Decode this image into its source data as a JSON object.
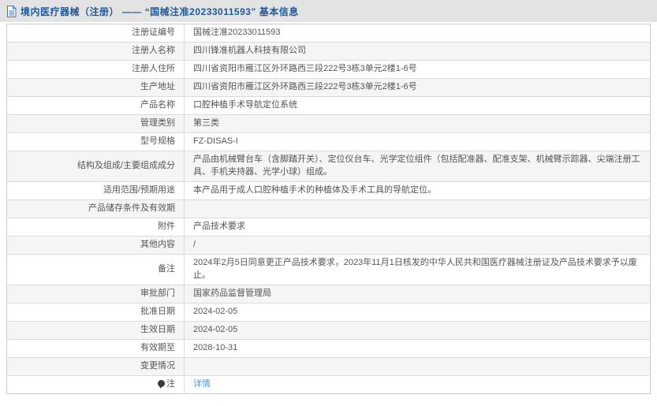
{
  "header": {
    "title": "境内医疗器械（注册） —— “国械注准20233011593” 基本信息",
    "icon": "document-icon",
    "title_color": "#1c5a9e",
    "band_color": "#e3e3e3"
  },
  "colors": {
    "stripe": "#f5f5f5",
    "border": "#dcdcdc",
    "link": "#4b94e0",
    "text": "#555555"
  },
  "table": {
    "rows": [
      {
        "label": "注册证编号",
        "value": "国械注准20233011593"
      },
      {
        "label": "注册人名称",
        "value": "四川锋准机器人科技有限公司"
      },
      {
        "label": "注册人住所",
        "value": "四川省资阳市雁江区外环路西三段222号3栋3单元2楼1-6号"
      },
      {
        "label": "生产地址",
        "value": "四川省资阳市雁江区外环路西三段222号3栋3单元2楼1-6号"
      },
      {
        "label": "产品名称",
        "value": "口腔种植手术导航定位系统"
      },
      {
        "label": "管理类别",
        "value": "第三类"
      },
      {
        "label": "型号规格",
        "value": "FZ-DISAS-I"
      },
      {
        "label": "结构及组成/主要组成成分",
        "value": "产品由机械臂台车（含脚踏开关）、定位仪台车、光学定位组件（包括配准器、配准支架、机械臂示踪器、尖端注册工具、手机夹持器、光学小球）组成。"
      },
      {
        "label": "适用范围/预期用途",
        "value": "本产品用于成人口腔种植手术的种植体及手术工具的导航定位。"
      },
      {
        "label": "产品储存条件及有效期",
        "value": ""
      },
      {
        "label": "附件",
        "value": "产品技术要求"
      },
      {
        "label": "其他内容",
        "value": "/"
      },
      {
        "label": "备注",
        "value": "2024年2月5日同意更正产品技术要求，2023年11月1日核发的中华人民共和国医疗器械注册证及产品技术要求予以废止。"
      },
      {
        "label": "审批部门",
        "value": "国家药品监督管理局"
      },
      {
        "label": "批准日期",
        "value": "2024-02-05"
      },
      {
        "label": "生效日期",
        "value": "2024-02-05"
      },
      {
        "label": "有效期至",
        "value": "2028-10-31"
      },
      {
        "label": "变更情况",
        "value": ""
      },
      {
        "label": "注",
        "value": "详情",
        "icon": "note-icon",
        "link": true
      }
    ]
  }
}
